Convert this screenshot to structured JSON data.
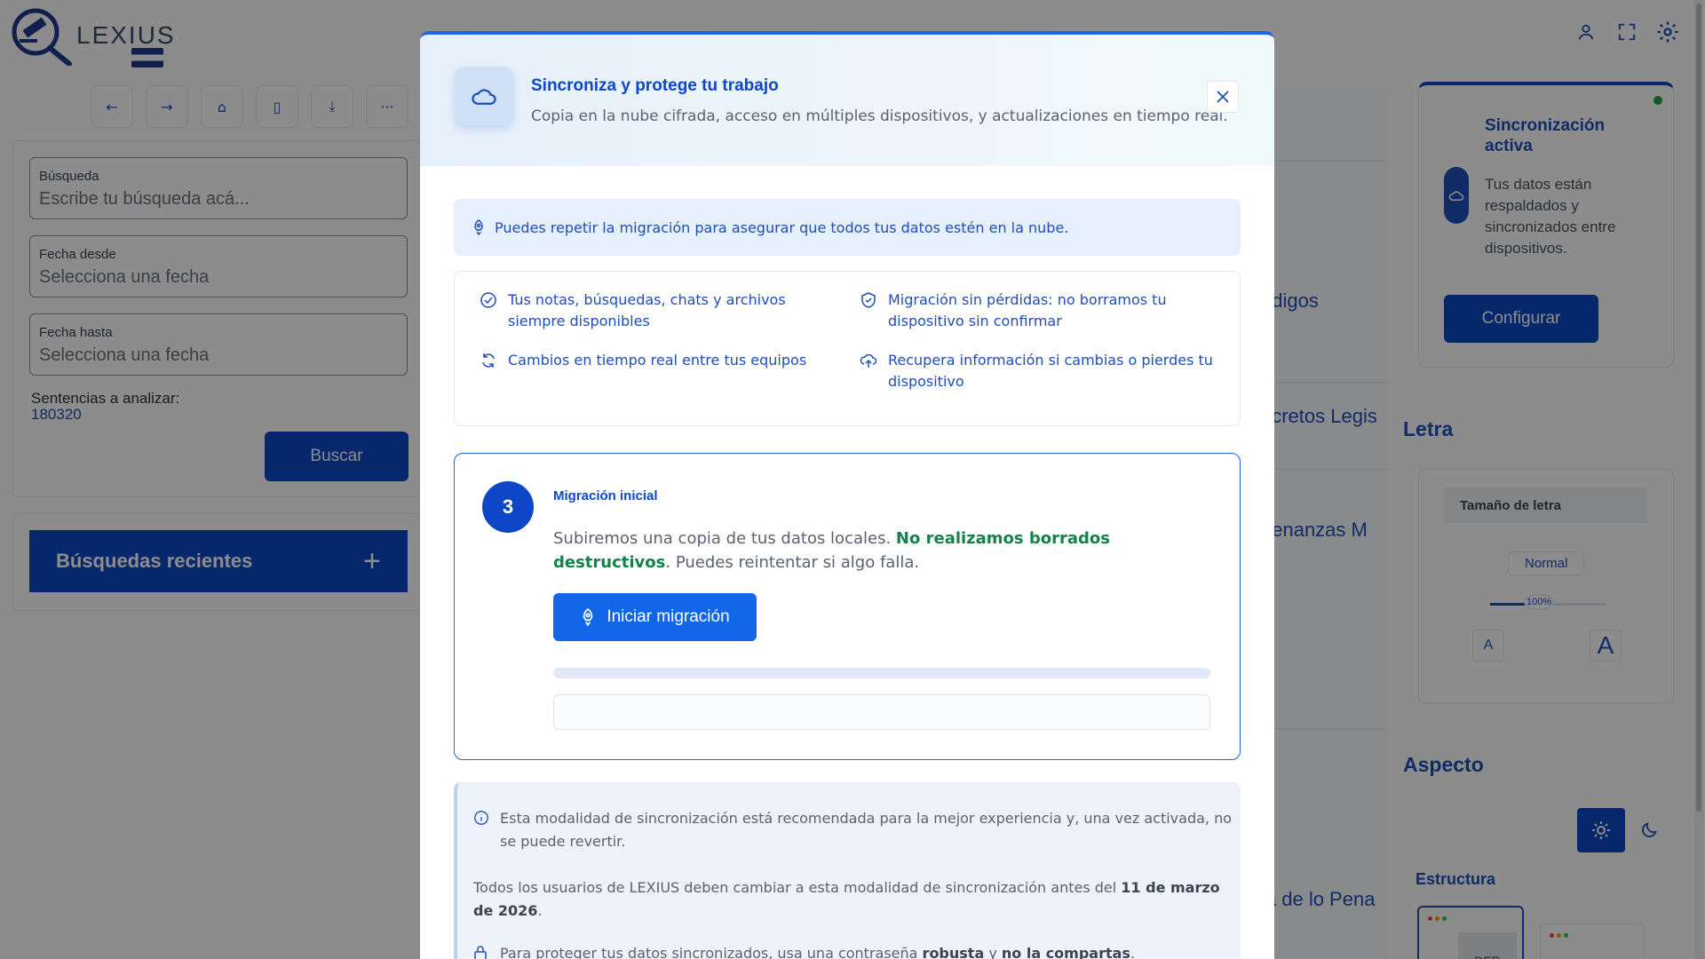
{
  "app": {
    "logo_text": "LEXIUS",
    "search_label": "Búsqueda",
    "search_placeholder": "Escribe tu búsqueda acá...",
    "date_from_label": "Fecha desde",
    "date_from_placeholder": "Selecciona una fecha",
    "date_to_label": "Fecha hasta",
    "date_to_placeholder": "Selecciona una fecha",
    "count_label": "Sentencias a analizar:",
    "count_value": "180320",
    "search_button": "Buscar",
    "recent_title": "Búsquedas recientes",
    "recent_plus": "+",
    "middle_items": [
      "ódigos",
      "ecretos Legis",
      "denanzas M",
      "la de lo Pena"
    ],
    "sync_card": {
      "title": "Sincronización activa",
      "description": "Tus datos están respaldados y sincronizados entre dispositivos.",
      "button": "Configurar"
    },
    "letra": {
      "section_title": "Letra",
      "head": "Tamaño de letra",
      "current": "Normal",
      "percent_label": "100%",
      "size_fraction": 0.3,
      "small_a": "A",
      "big_a": "A"
    },
    "aspecto_title": "Aspecto",
    "estructura_title": "Estructura",
    "layout_label": "DER"
  },
  "modal": {
    "title": "Sincroniza y protege tu trabajo",
    "subtitle": "Copia en la nube cifrada, acceso en múltiples dispositivos, y actualizaciones en tiempo real.",
    "tip": "Puedes repetir la migración para asegurar que todos tus datos estén en la nube.",
    "features": [
      {
        "icon": "check-circle-icon",
        "text": "Tus notas, búsquedas, chats y archivos siempre disponibles"
      },
      {
        "icon": "shield-check-icon",
        "text": "Migración sin pérdidas: no borramos tu dispositivo sin confirmar"
      },
      {
        "icon": "refresh-icon",
        "text": "Cambios en tiempo real entre tus equipos"
      },
      {
        "icon": "cloud-upload-icon",
        "text": "Recupera información si cambias o pierdes tu dispositivo"
      }
    ],
    "step": {
      "number": "3",
      "title": "Migración inicial",
      "desc_part1": "Subiremos una copia de tus datos locales. ",
      "desc_bold": "No realizamos borrados destructivos",
      "desc_part2": ". Puedes reintentar si algo falla.",
      "button": "Iniciar migración",
      "progress_fraction": 0,
      "log": ""
    },
    "notice": {
      "p1": "Esta modalidad de sincronización está recomendada para la mejor experiencia y, una vez activada, no se puede revertir.",
      "p2_part1": "Todos los usuarios de LEXIUS deben cambiar a esta modalidad de sincronización antes del ",
      "p2_bold": "11 de marzo de 2026",
      "p2_part2": ".",
      "p3_part1": "Para proteger tus datos sincronizados, usa una contraseña ",
      "p3_bold1": "robusta",
      "p3_part2": " y ",
      "p3_bold2": "no la compartas",
      "p3_part3": "."
    }
  },
  "colors": {
    "primary": "#0d47c7",
    "accent_blue": "#1167e8",
    "success_green": "#14834a",
    "status_dot": "#22a34a"
  }
}
